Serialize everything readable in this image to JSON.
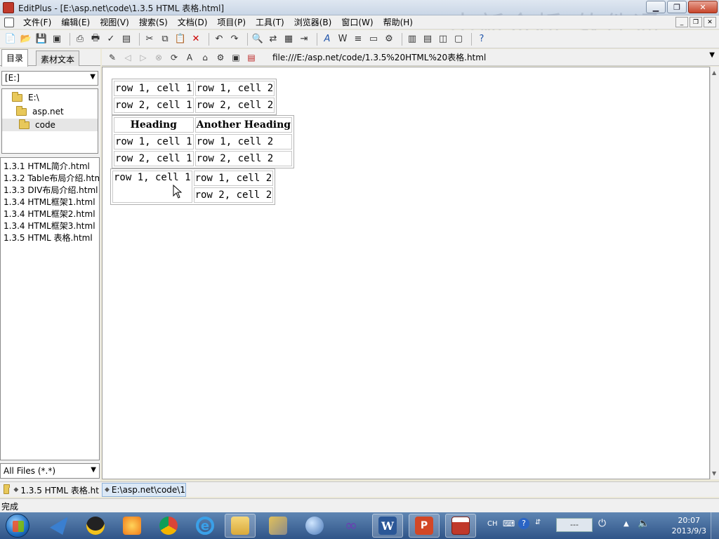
{
  "window": {
    "title": "EditPlus - [E:\\asp.net\\code\\1.3.5 HTML 表格.html]",
    "watermark": "中新金桥  软件通"
  },
  "menu": [
    "文件(F)",
    "编辑(E)",
    "视图(V)",
    "搜索(S)",
    "文档(D)",
    "项目(P)",
    "工具(T)",
    "浏览器(B)",
    "窗口(W)",
    "帮助(H)"
  ],
  "left_panel": {
    "tabs": [
      "目录",
      "素材文本"
    ],
    "drive": "[E:]",
    "dirs": [
      "E:\\",
      "asp.net",
      "code"
    ],
    "files": [
      "1.3.1 HTML简介.html",
      "1.3.2 Table布局介绍.htm",
      "1.3.3 DIV布局介绍.html",
      "1.3.4 HTML框架1.html",
      "1.3.4 HTML框架2.html",
      "1.3.4 HTML框架3.html",
      "1.3.5 HTML 表格.html"
    ],
    "filter": "All Files (*.*)"
  },
  "browser": {
    "address": "file:///E:/asp.net/code/1.3.5%20HTML%20表格.html",
    "table1": [
      [
        "row 1, cell 1",
        "row 1, cell 2"
      ],
      [
        "row 2, cell 1",
        "row 2, cell 2"
      ]
    ],
    "table2": {
      "headers": [
        "Heading",
        "Another Heading"
      ],
      "rows": [
        [
          "row 1, cell 1",
          "row 1, cell 2"
        ],
        [
          "row 2, cell 1",
          "row 2, cell 2"
        ]
      ]
    },
    "table3": {
      "r1c1": "row 1, cell 1",
      "r1c2": "row 1, cell 2",
      "r2c2": "row 2, cell 2"
    }
  },
  "doc_tabs": [
    "1.3.5 HTML 表格.ht",
    "E:\\asp.net\\code\\1."
  ],
  "status": "完成",
  "taskbar": {
    "ime": "CH",
    "ime_box": "---",
    "time": "20:07",
    "date": "2013/9/3"
  }
}
